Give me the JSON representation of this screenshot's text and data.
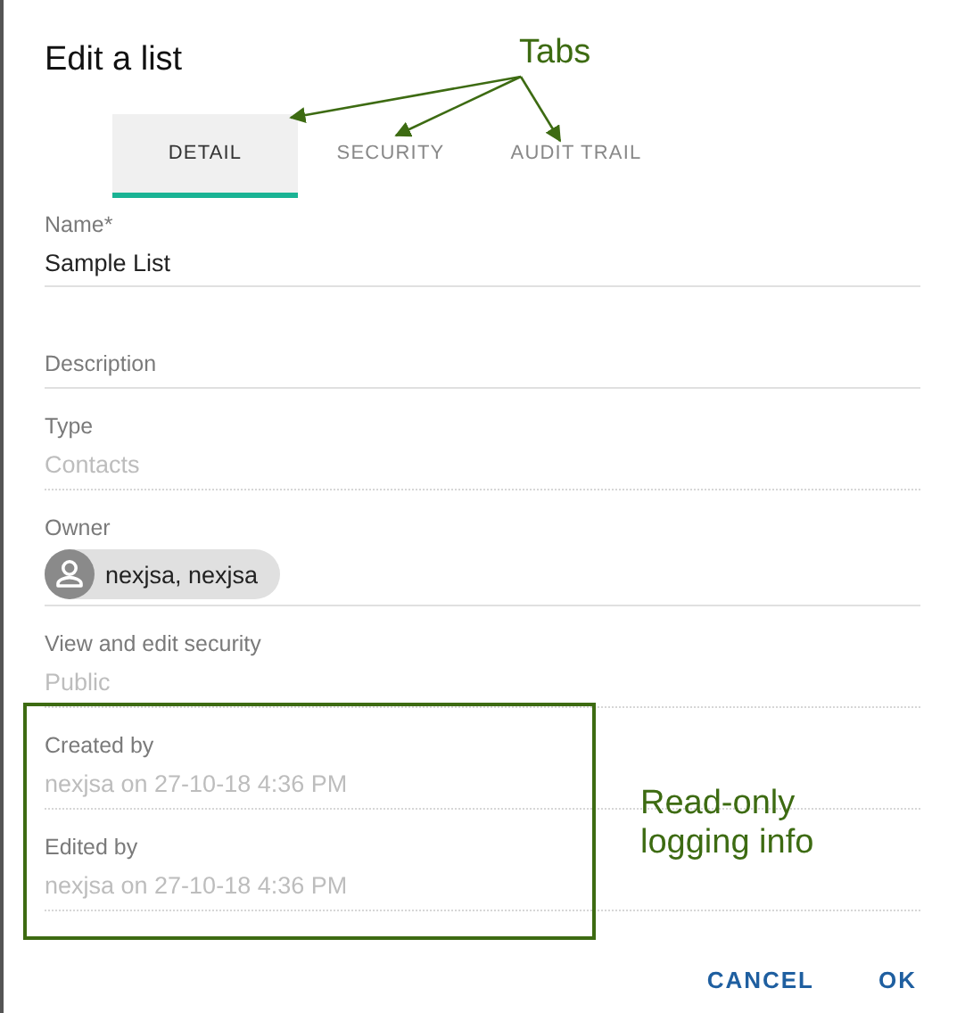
{
  "dialog": {
    "title": "Edit a list"
  },
  "tabs": [
    {
      "label": "DETAIL",
      "selected": true
    },
    {
      "label": "SECURITY",
      "selected": false
    },
    {
      "label": "AUDIT TRAIL",
      "selected": false
    }
  ],
  "fields": [
    {
      "kind": "input",
      "label": "Name*",
      "value": "Sample List"
    },
    {
      "kind": "empty",
      "label": "Description"
    },
    {
      "kind": "readonly",
      "label": "Type",
      "value": "Contacts"
    },
    {
      "kind": "chip",
      "label": "Owner",
      "value": "nexjsa, nexjsa"
    },
    {
      "kind": "readonly",
      "label": "View and edit security",
      "value": "Public"
    },
    {
      "kind": "readonly",
      "label": "Created by",
      "value": "nexjsa on 27-10-18 4:36 PM"
    },
    {
      "kind": "readonly",
      "label": "Edited by",
      "value": "nexjsa on 27-10-18 4:36 PM"
    }
  ],
  "buttons": [
    "CANCEL",
    "OK"
  ],
  "annotations": {
    "tabs_callout": "Tabs",
    "logging_callout": "Read-only logging info"
  }
}
